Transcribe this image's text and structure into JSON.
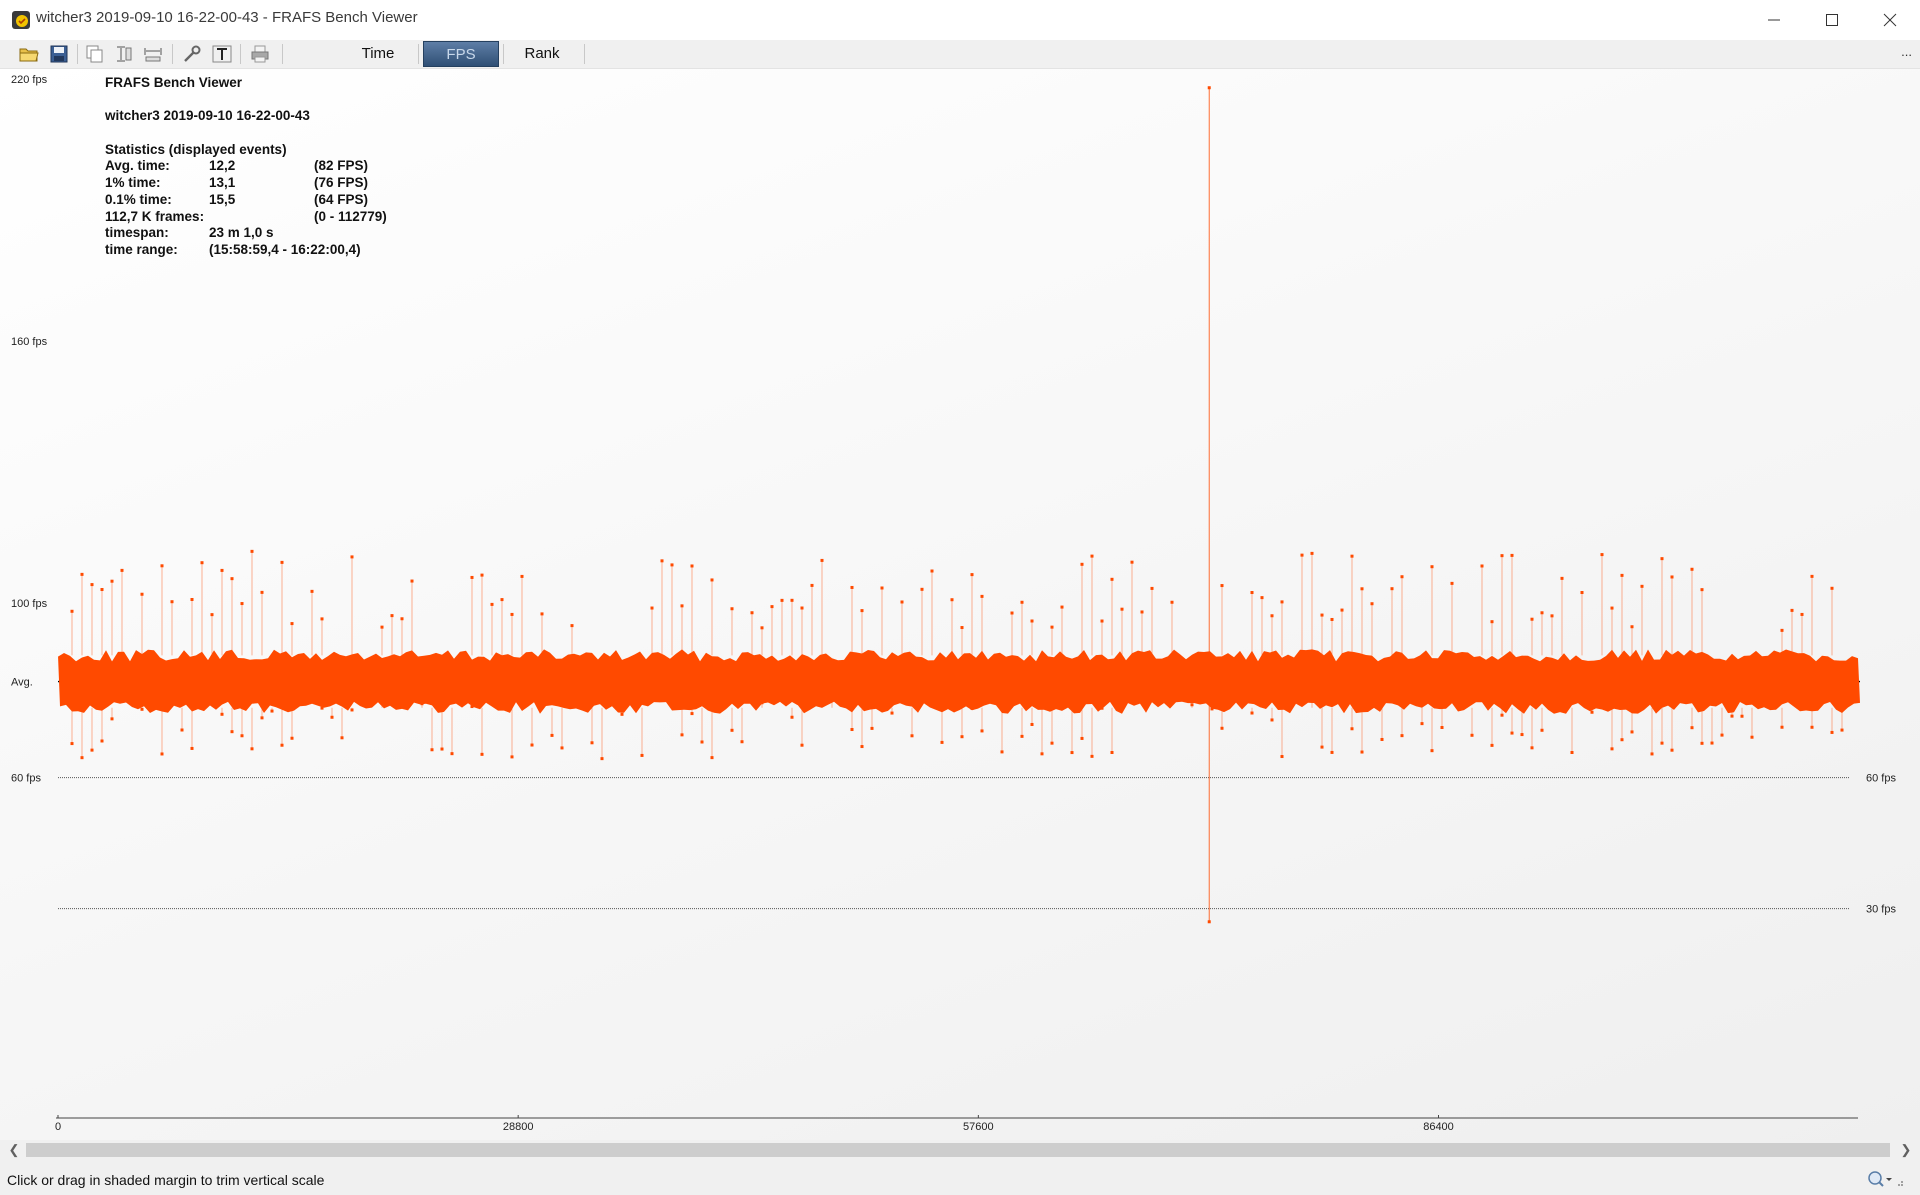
{
  "window": {
    "title": "witcher3 2019-09-10 16-22-00-43 - FRAFS Bench Viewer"
  },
  "toolbar": {
    "modes": [
      {
        "label": "Time",
        "active": false
      },
      {
        "label": "FPS",
        "active": true
      },
      {
        "label": "Rank",
        "active": false
      }
    ],
    "more_label": "..."
  },
  "stats": {
    "app_name": "FRAFS Bench Viewer",
    "bench_name": "witcher3 2019-09-10 16-22-00-43",
    "header": "Statistics (displayed events)",
    "rows": [
      {
        "label": "Avg. time:",
        "value": "12,2",
        "extra": "(82 FPS)"
      },
      {
        "label": "1% time:",
        "value": "13,1",
        "extra": "(76 FPS)"
      },
      {
        "label": "0.1% time:",
        "value": "15,5",
        "extra": "(64 FPS)"
      },
      {
        "label": "112,7 K frames:",
        "value": "",
        "extra": "(0 - 112779)"
      },
      {
        "label": "timespan:",
        "value": "23 m 1,0 s",
        "extra": ""
      },
      {
        "label": "time range:",
        "value": "(15:58:59,4 - 16:22:00,4)",
        "extra": ""
      }
    ]
  },
  "chart_data": {
    "type": "line",
    "series_color": "#ff4a00",
    "x_range": [
      0,
      112779
    ],
    "x_ticks": [
      {
        "value": 0,
        "label": "0"
      },
      {
        "value": 28800,
        "label": "28800"
      },
      {
        "value": 57600,
        "label": "57600"
      },
      {
        "value": 86400,
        "label": "86400"
      }
    ],
    "y_ticks_left": [
      {
        "value": 220,
        "label": "220 fps"
      },
      {
        "value": 160,
        "label": "160 fps"
      },
      {
        "value": 100,
        "label": "100 fps"
      },
      {
        "value": 82,
        "label": "Avg."
      },
      {
        "value": 60,
        "label": "60 fps"
      }
    ],
    "reference_lines": [
      {
        "fps": 82,
        "label": "",
        "style": "dashed"
      },
      {
        "fps": 60,
        "label": "60 fps",
        "style": "dotted"
      },
      {
        "fps": 30,
        "label": "30 fps",
        "style": "dotted"
      }
    ],
    "avg_fps": 82,
    "band_low_fps": 76,
    "band_high_fps": 88,
    "spike_low_fps": 64,
    "spike_high_fps": 112,
    "outlier": {
      "frame": 72050,
      "max_fps": 218,
      "min_fps": 27
    }
  },
  "statusbar": {
    "text": "Click or drag in shaded margin to trim vertical scale"
  }
}
